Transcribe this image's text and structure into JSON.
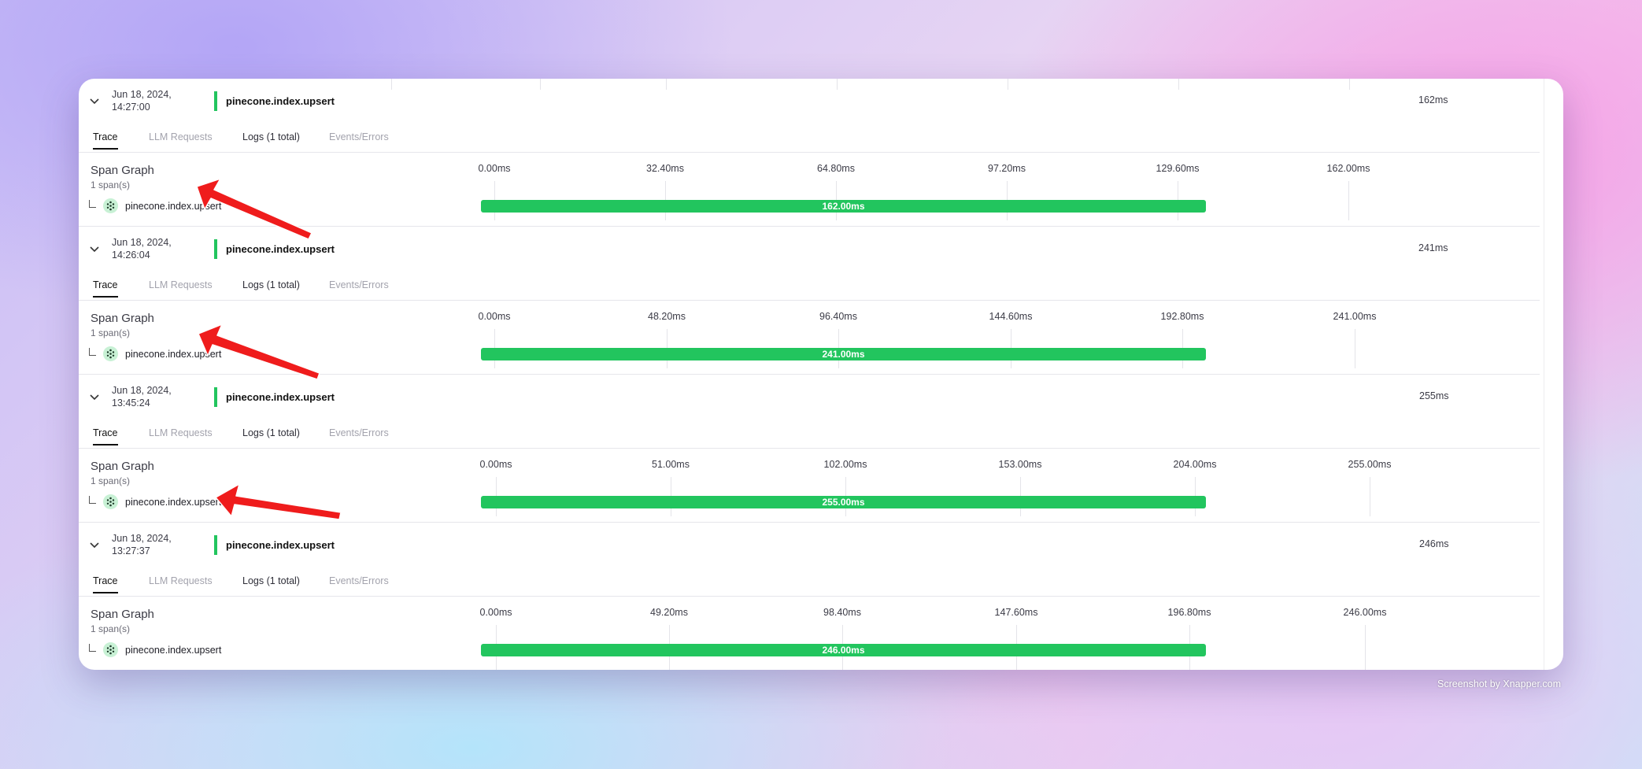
{
  "tabs": {
    "trace": "Trace",
    "llm": "LLM Requests",
    "logs": "Logs (1 total)",
    "events": "Events/Errors"
  },
  "span_graph": {
    "title": "Span Graph",
    "count": "1 span(s)"
  },
  "traces": [
    {
      "date": "Jun 18, 2024,",
      "time": "14:27:00",
      "name": "pinecone.index.upsert",
      "duration": "162ms",
      "span_name": "pinecone.index.upsert",
      "ticks": [
        "0.00ms",
        "32.40ms",
        "64.80ms",
        "97.20ms",
        "129.60ms",
        "162.00ms"
      ],
      "bar_label": "162.00ms"
    },
    {
      "date": "Jun 18, 2024,",
      "time": "14:26:04",
      "name": "pinecone.index.upsert",
      "duration": "241ms",
      "span_name": "pinecone.index.upsert",
      "ticks": [
        "0.00ms",
        "48.20ms",
        "96.40ms",
        "144.60ms",
        "192.80ms",
        "241.00ms"
      ],
      "bar_label": "241.00ms"
    },
    {
      "date": "Jun 18, 2024,",
      "time": "13:45:24",
      "name": "pinecone.index.upsert",
      "duration": "255ms",
      "span_name": "pinecone.index.upsert",
      "ticks": [
        "0.00ms",
        "51.00ms",
        "102.00ms",
        "153.00ms",
        "204.00ms",
        "255.00ms"
      ],
      "bar_label": "255.00ms"
    },
    {
      "date": "Jun 18, 2024,",
      "time": "13:27:37",
      "name": "pinecone.index.upsert",
      "duration": "246ms",
      "span_name": "pinecone.index.upsert",
      "ticks": [
        "0.00ms",
        "49.20ms",
        "98.40ms",
        "147.60ms",
        "196.80ms",
        "246.00ms"
      ],
      "bar_label": "246.00ms"
    }
  ],
  "credit": "Screenshot by Xnapper.com",
  "colors": {
    "accent_green": "#22c55e",
    "annotation_arrow": "#ef1c1c"
  }
}
